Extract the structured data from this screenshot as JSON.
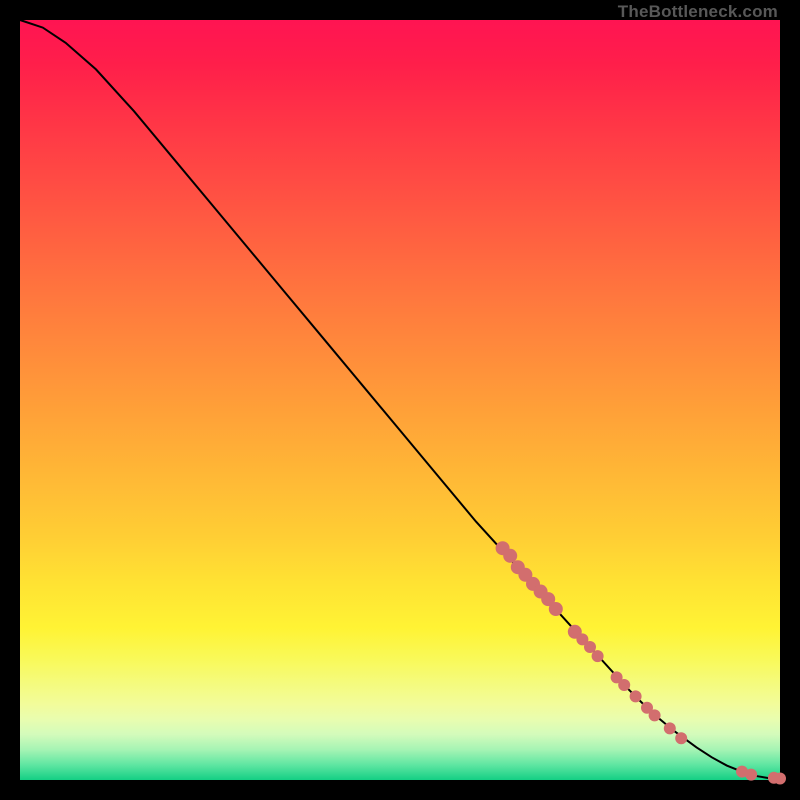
{
  "attribution": "TheBottleneck.com",
  "colors": {
    "page_bg": "#000000",
    "line": "#000000",
    "point": "#d26e6e",
    "gradient_top": "#ff1452",
    "gradient_bottom": "#14cf84"
  },
  "chart_data": {
    "type": "line",
    "title": "",
    "xlabel": "",
    "ylabel": "",
    "xlim": [
      0,
      100
    ],
    "ylim": [
      0,
      100
    ],
    "grid": false,
    "legend": false,
    "series": [
      {
        "name": "bottleneck-curve",
        "x": [
          0,
          3,
          6,
          10,
          15,
          20,
          25,
          30,
          35,
          40,
          45,
          50,
          55,
          60,
          65,
          70,
          75,
          80,
          83,
          86,
          89,
          91,
          93,
          95,
          97,
          98.5,
          100
        ],
        "y": [
          100,
          99,
          97,
          93.5,
          88,
          82,
          76,
          70,
          64,
          58,
          52,
          46,
          40,
          34,
          28.5,
          23,
          17.5,
          12,
          9,
          6.5,
          4.3,
          3,
          1.9,
          1.1,
          0.5,
          0.25,
          0.2
        ]
      }
    ],
    "points": [
      {
        "x": 63.5,
        "y": 30.5,
        "r": 7
      },
      {
        "x": 64.5,
        "y": 29.5,
        "r": 7
      },
      {
        "x": 65.5,
        "y": 28.0,
        "r": 7
      },
      {
        "x": 66.5,
        "y": 27.0,
        "r": 7
      },
      {
        "x": 67.5,
        "y": 25.8,
        "r": 7
      },
      {
        "x": 68.5,
        "y": 24.8,
        "r": 7
      },
      {
        "x": 69.5,
        "y": 23.8,
        "r": 7
      },
      {
        "x": 70.5,
        "y": 22.5,
        "r": 7
      },
      {
        "x": 73.0,
        "y": 19.5,
        "r": 7
      },
      {
        "x": 74.0,
        "y": 18.5,
        "r": 6
      },
      {
        "x": 75.0,
        "y": 17.5,
        "r": 6
      },
      {
        "x": 76.0,
        "y": 16.3,
        "r": 6
      },
      {
        "x": 78.5,
        "y": 13.5,
        "r": 6
      },
      {
        "x": 79.5,
        "y": 12.5,
        "r": 6
      },
      {
        "x": 81.0,
        "y": 11.0,
        "r": 6
      },
      {
        "x": 82.5,
        "y": 9.5,
        "r": 6
      },
      {
        "x": 83.5,
        "y": 8.5,
        "r": 6
      },
      {
        "x": 85.5,
        "y": 6.8,
        "r": 6
      },
      {
        "x": 87.0,
        "y": 5.5,
        "r": 6
      },
      {
        "x": 95.0,
        "y": 1.1,
        "r": 6
      },
      {
        "x": 96.2,
        "y": 0.7,
        "r": 6
      },
      {
        "x": 99.2,
        "y": 0.3,
        "r": 6
      },
      {
        "x": 100.0,
        "y": 0.2,
        "r": 6
      }
    ]
  }
}
